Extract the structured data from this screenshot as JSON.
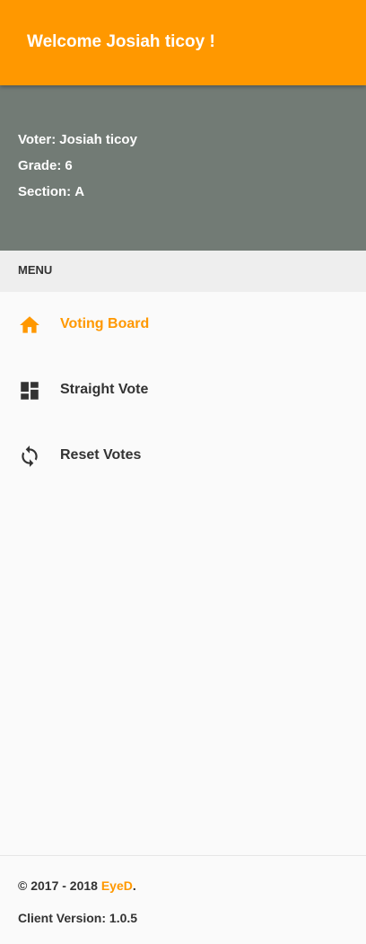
{
  "header": {
    "title": "Welcome Josiah ticoy !"
  },
  "voter": {
    "voter_label": "Voter:",
    "voter_name": "Josiah ticoy",
    "grade_label": "Grade:",
    "grade": "6",
    "section_label": "Section:",
    "section": "A"
  },
  "menu": {
    "header": "MENU",
    "items": [
      {
        "label": "Voting Board",
        "icon": "home-icon",
        "active": true
      },
      {
        "label": "Straight Vote",
        "icon": "dashboard-icon",
        "active": false
      },
      {
        "label": "Reset Votes",
        "icon": "sync-icon",
        "active": false
      }
    ]
  },
  "footer": {
    "copyright_prefix": "© 2017 - 2018",
    "brand": "EyeD",
    "copyright_suffix": ".",
    "version": "Client Version: 1.0.5"
  },
  "colors": {
    "accent": "#ff9800",
    "voter_panel": "#727b75",
    "menu_header_bg": "#eeeeee",
    "text": "#333333"
  }
}
